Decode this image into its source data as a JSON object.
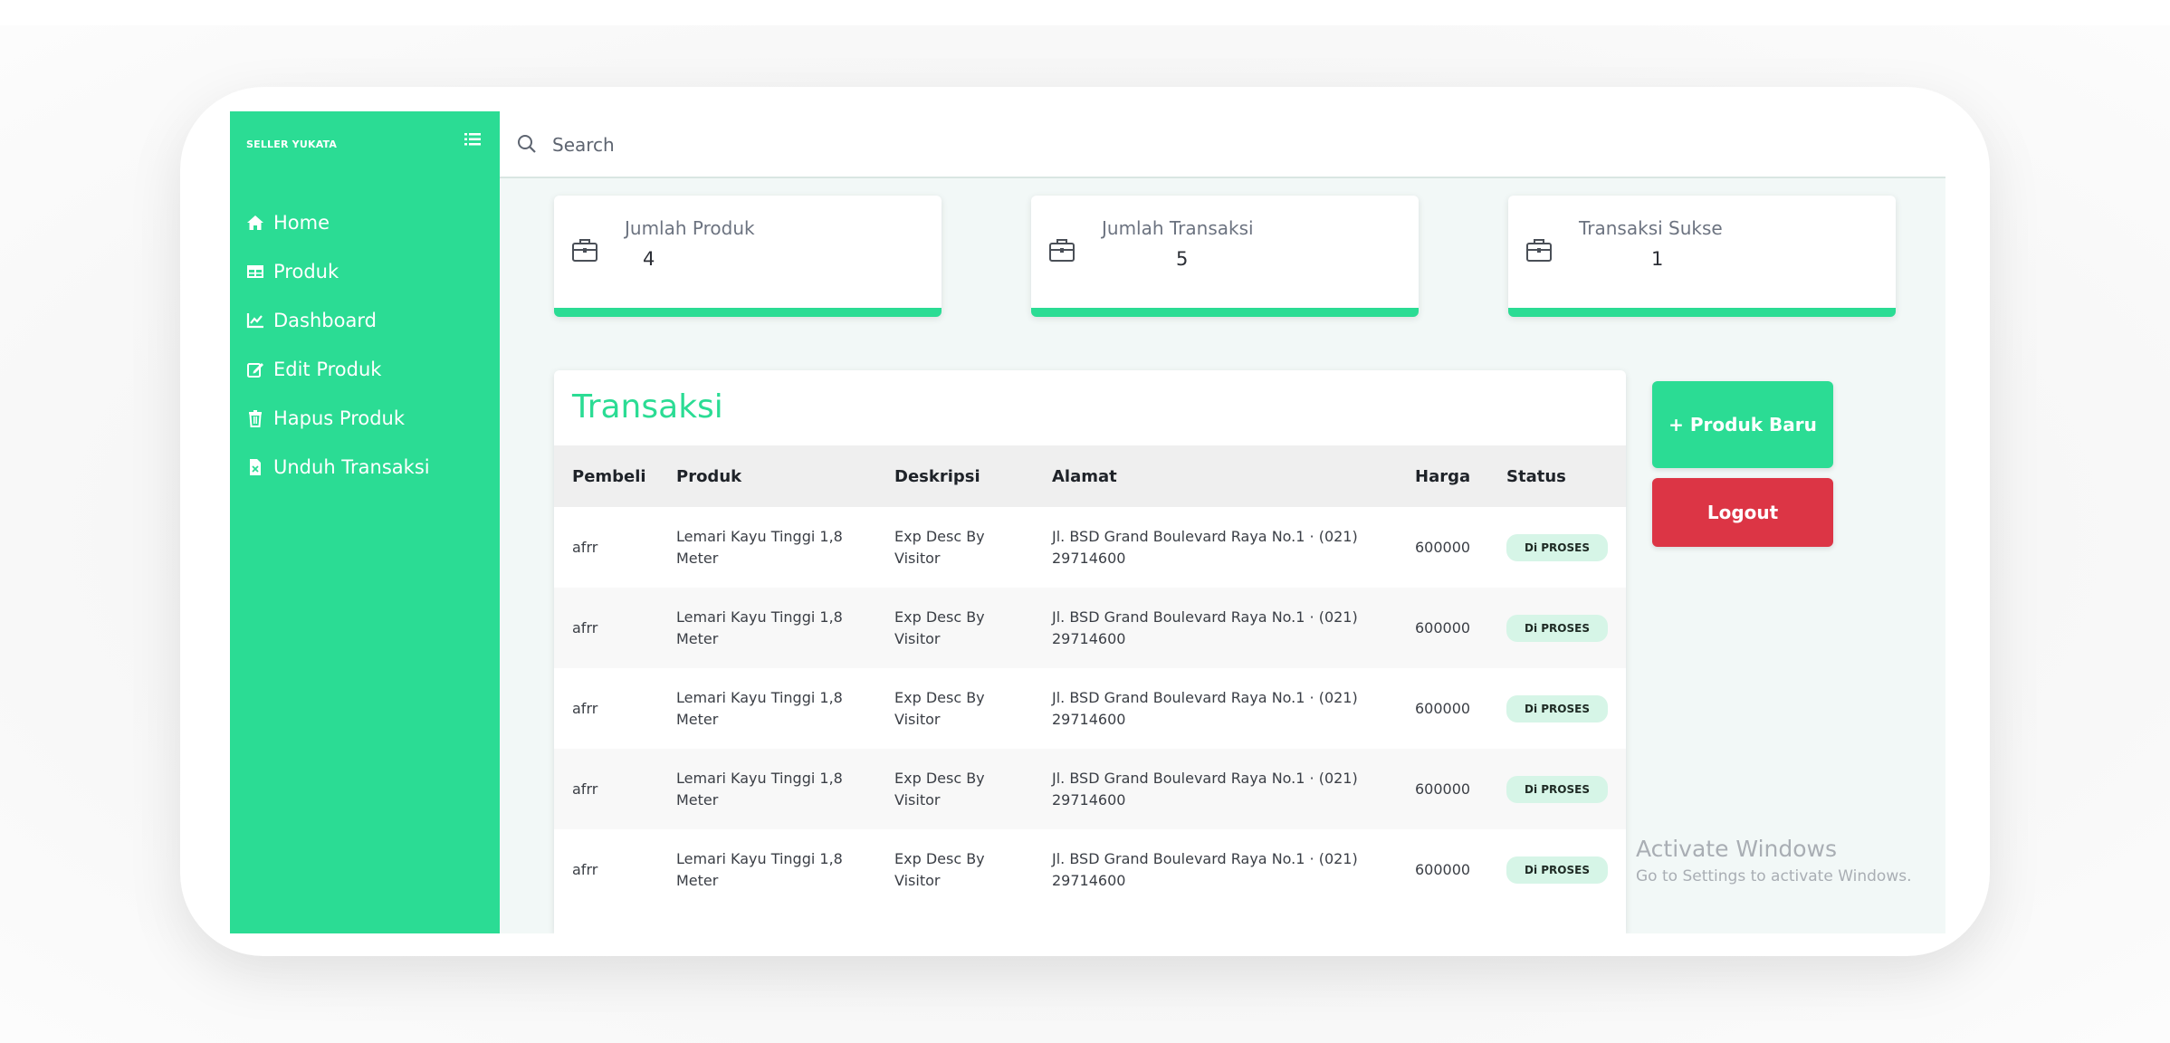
{
  "sidebar": {
    "brand": "SELLER YUKATA",
    "items": [
      {
        "label": "Home",
        "icon": "home-icon"
      },
      {
        "label": "Produk",
        "icon": "table-icon"
      },
      {
        "label": "Dashboard",
        "icon": "chart-line-icon"
      },
      {
        "label": "Edit Produk",
        "icon": "edit-icon"
      },
      {
        "label": "Hapus Produk",
        "icon": "trash-icon"
      },
      {
        "label": "Unduh Transaksi",
        "icon": "file-download-icon"
      }
    ]
  },
  "search": {
    "placeholder": "Search",
    "value": ""
  },
  "stats": [
    {
      "label": "Jumlah Produk",
      "value": "4",
      "icon": "briefcase-icon"
    },
    {
      "label": "Jumlah Transaksi",
      "value": "5",
      "icon": "briefcase-icon"
    },
    {
      "label": "Transaksi Sukse",
      "value": "1",
      "icon": "briefcase-icon"
    }
  ],
  "transactions": {
    "title": "Transaksi",
    "columns": [
      "Pembeli",
      "Produk",
      "Deskripsi",
      "Alamat",
      "Harga",
      "Status"
    ],
    "rows": [
      {
        "pembeli": "afrr",
        "produk": "Lemari Kayu Tinggi 1,8 Meter",
        "deskripsi": "Exp Desc By Visitor",
        "alamat": "Jl. BSD Grand Boulevard Raya No.1 · (021) 29714600",
        "harga": "600000",
        "status": "Di PROSES"
      },
      {
        "pembeli": "afrr",
        "produk": "Lemari Kayu Tinggi 1,8 Meter",
        "deskripsi": "Exp Desc By Visitor",
        "alamat": "Jl. BSD Grand Boulevard Raya No.1 · (021) 29714600",
        "harga": "600000",
        "status": "Di PROSES"
      },
      {
        "pembeli": "afrr",
        "produk": "Lemari Kayu Tinggi 1,8 Meter",
        "deskripsi": "Exp Desc By Visitor",
        "alamat": "Jl. BSD Grand Boulevard Raya No.1 · (021) 29714600",
        "harga": "600000",
        "status": "Di PROSES"
      },
      {
        "pembeli": "afrr",
        "produk": "Lemari Kayu Tinggi 1,8 Meter",
        "deskripsi": "Exp Desc By Visitor",
        "alamat": "Jl. BSD Grand Boulevard Raya No.1 · (021) 29714600",
        "harga": "600000",
        "status": "Di PROSES"
      },
      {
        "pembeli": "afrr",
        "produk": "Lemari Kayu Tinggi 1,8 Meter",
        "deskripsi": "Exp Desc By Visitor",
        "alamat": "Jl. BSD Grand Boulevard Raya No.1 · (021) 29714600",
        "harga": "600000",
        "status": "Di PROSES"
      }
    ]
  },
  "actions": {
    "new_product": "+ Produk Baru",
    "logout": "Logout"
  },
  "watermark": {
    "title": "Activate Windows",
    "subtitle": "Go to Settings to activate Windows."
  },
  "colors": {
    "accent": "#2bdc94",
    "danger": "#dc3545",
    "badge_bg": "#d6f5e7"
  }
}
